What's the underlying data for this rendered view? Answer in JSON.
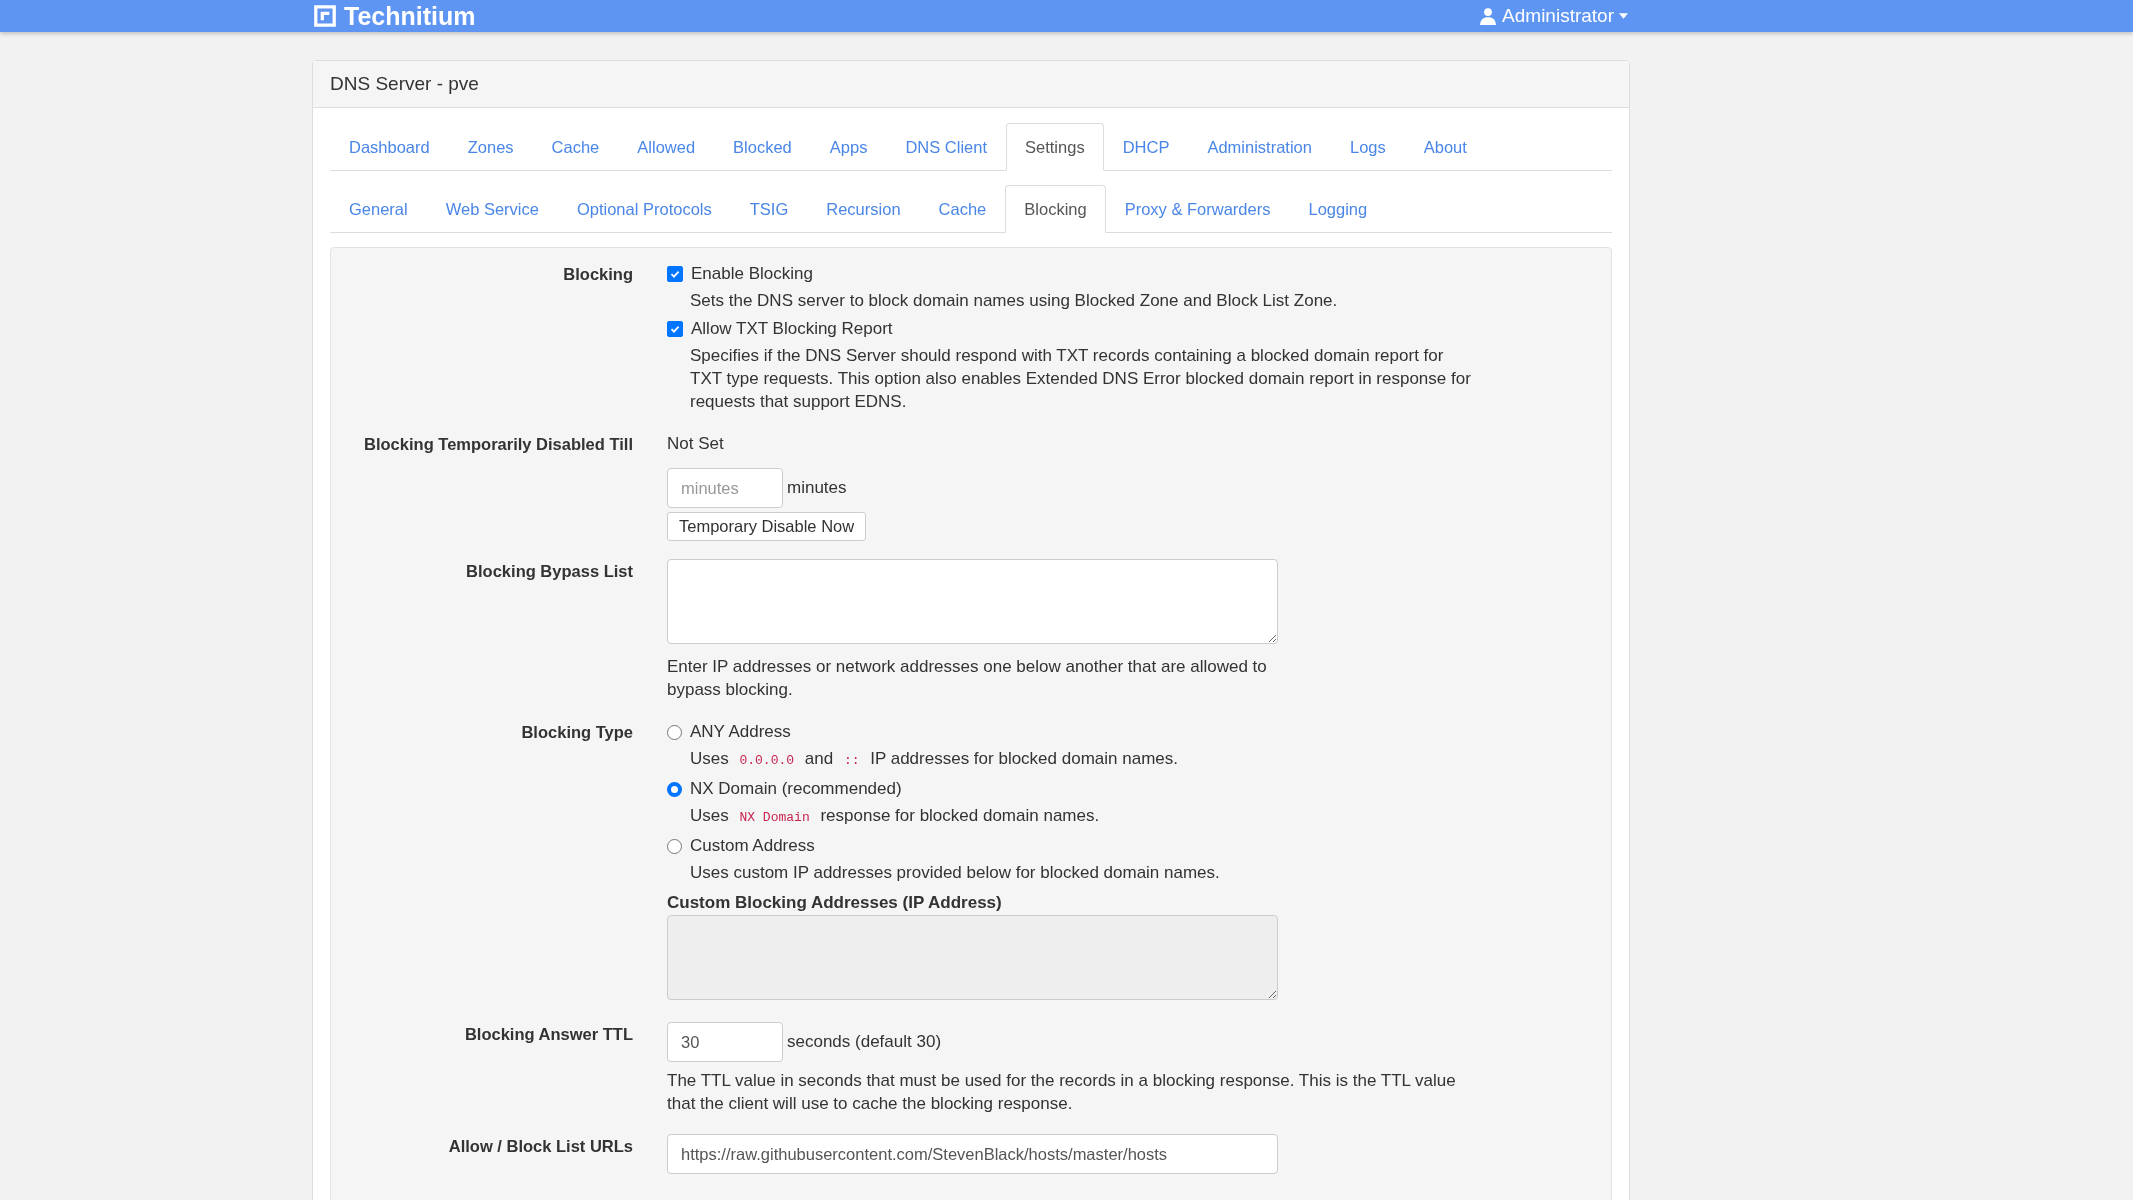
{
  "header": {
    "brand": "Technitium",
    "user": "Administrator"
  },
  "panel": {
    "title": "DNS Server - pve"
  },
  "tabs": [
    {
      "label": "Dashboard",
      "selected": false
    },
    {
      "label": "Zones",
      "selected": false
    },
    {
      "label": "Cache",
      "selected": false
    },
    {
      "label": "Allowed",
      "selected": false
    },
    {
      "label": "Blocked",
      "selected": false
    },
    {
      "label": "Apps",
      "selected": false
    },
    {
      "label": "DNS Client",
      "selected": false
    },
    {
      "label": "Settings",
      "selected": true
    },
    {
      "label": "DHCP",
      "selected": false
    },
    {
      "label": "Administration",
      "selected": false
    },
    {
      "label": "Logs",
      "selected": false
    },
    {
      "label": "About",
      "selected": false
    }
  ],
  "subtabs": [
    {
      "label": "General",
      "selected": false
    },
    {
      "label": "Web Service",
      "selected": false
    },
    {
      "label": "Optional Protocols",
      "selected": false
    },
    {
      "label": "TSIG",
      "selected": false
    },
    {
      "label": "Recursion",
      "selected": false
    },
    {
      "label": "Cache",
      "selected": false
    },
    {
      "label": "Blocking",
      "selected": true
    },
    {
      "label": "Proxy & Forwarders",
      "selected": false
    },
    {
      "label": "Logging",
      "selected": false
    }
  ],
  "rows": [
    {
      "label": "Blocking",
      "items": [
        {
          "kind": "checkbox",
          "label": "Enable Blocking",
          "checked": true,
          "help": [
            {
              "kind": "text",
              "text": "Sets the DNS server to block domain names using Blocked Zone and Block List Zone."
            }
          ]
        },
        {
          "kind": "checkbox",
          "label": "Allow TXT Blocking Report",
          "checked": true,
          "help": [
            {
              "kind": "text",
              "text": "Specifies if the DNS Server should respond with TXT records containing a blocked domain report for TXT type requests. This option also enables Extended DNS Error blocked domain report in response for requests that support EDNS."
            }
          ]
        }
      ]
    },
    {
      "label": "Blocking Temporarily Disabled Till",
      "items": [
        {
          "kind": "text",
          "text": "Not Set"
        },
        {
          "kind": "input",
          "placeholder": "minutes",
          "suffix": "minutes"
        },
        {
          "kind": "button",
          "label": "Temporary Disable Now"
        }
      ]
    },
    {
      "label": "Blocking Bypass List",
      "items": [
        {
          "kind": "textarea",
          "disabled": false
        },
        {
          "kind": "help",
          "help": [
            {
              "kind": "text",
              "text": "Enter IP addresses or network addresses one below another that are allowed to bypass blocking."
            }
          ]
        }
      ]
    },
    {
      "label": "Blocking Type",
      "items": [
        {
          "kind": "radio",
          "label": "ANY Address",
          "selected": false,
          "help": [
            {
              "kind": "text",
              "text": "Uses "
            },
            {
              "kind": "code",
              "text": "0.0.0.0"
            },
            {
              "kind": "text",
              "text": " and "
            },
            {
              "kind": "code",
              "text": "::"
            },
            {
              "kind": "text",
              "text": " IP addresses for blocked domain names."
            }
          ]
        },
        {
          "kind": "radio",
          "label": "NX Domain (recommended)",
          "selected": true,
          "help": [
            {
              "kind": "text",
              "text": "Uses "
            },
            {
              "kind": "code",
              "text": "NX Domain"
            },
            {
              "kind": "text",
              "text": " response for blocked domain names."
            }
          ]
        },
        {
          "kind": "radio",
          "label": "Custom Address",
          "selected": false,
          "help": [
            {
              "kind": "text",
              "text": "Uses custom IP addresses provided below for blocked domain names."
            }
          ]
        },
        {
          "kind": "sublabel",
          "text": "Custom Blocking Addresses (IP Address)"
        },
        {
          "kind": "textarea",
          "disabled": true
        }
      ]
    },
    {
      "label": "Blocking Answer TTL",
      "items": [
        {
          "kind": "input",
          "value": "30",
          "suffix": "seconds (default 30)"
        },
        {
          "kind": "help",
          "help": [
            {
              "kind": "text",
              "text": "The TTL value in seconds that must be used for the records in a blocking response. This is the TTL value that the client will use to cache the blocking response."
            }
          ]
        }
      ]
    },
    {
      "label": "Allow / Block List URLs",
      "items": [
        {
          "kind": "wideinput",
          "value": "https://raw.githubusercontent.com/StevenBlack/hosts/master/hosts"
        }
      ]
    }
  ]
}
